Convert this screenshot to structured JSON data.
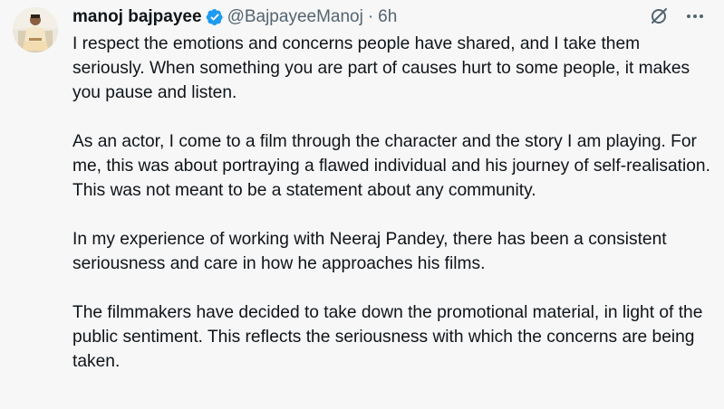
{
  "post": {
    "author": {
      "display_name": "manoj bajpayee",
      "verified_icon": "verified-badge-icon",
      "handle": "@BajpayeeManoj",
      "separator": "·",
      "time": "6h"
    },
    "actions": {
      "grok_icon": "grok-icon",
      "more_icon": "more-icon"
    },
    "paragraphs": [
      "I respect the emotions and concerns people have shared, and I take them seriously. When something you are part of causes hurt to some people, it makes you pause and listen.",
      "As an actor, I come to a film through the character and the story I am playing. For me, this was about portraying a flawed individual and his journey of self-realisation. This was not meant to be a statement about any community.",
      "In my experience of working with Neeraj Pandey, there has been a consistent seriousness and care in how he approaches his films.",
      "The filmmakers have decided to take down the promotional material, in light of the public sentiment. This reflects the seriousness with which the concerns are being taken."
    ]
  },
  "colors": {
    "text": "#0f1419",
    "secondary": "#536471",
    "verified": "#1d9bf0",
    "background": "#f7f7f7"
  }
}
